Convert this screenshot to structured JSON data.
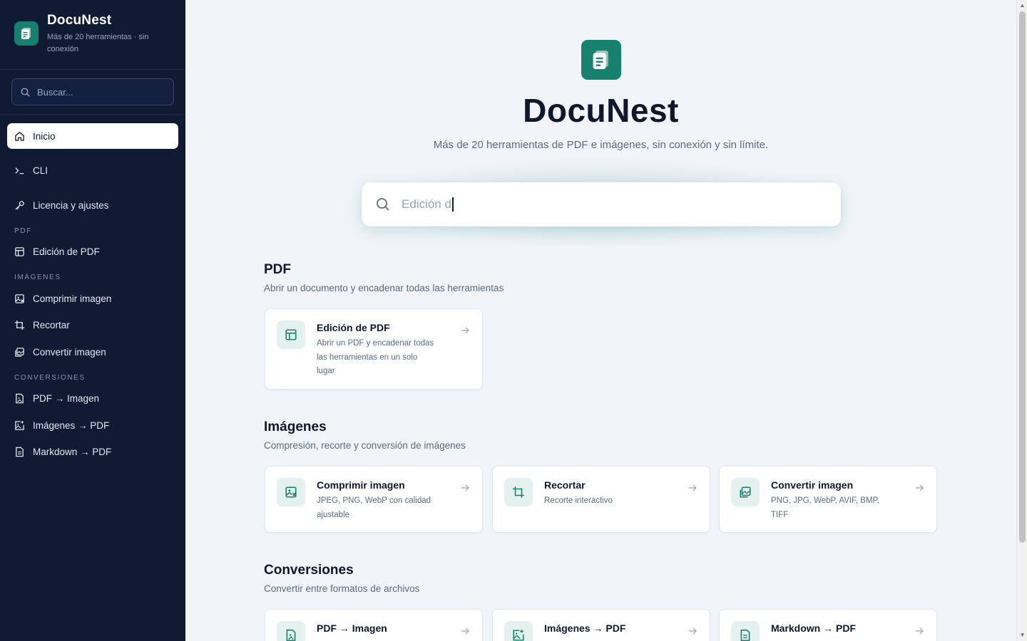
{
  "brand": {
    "title": "DocuNest",
    "subtitle": "Más de 20 herramientas · sin conexión"
  },
  "sidebar": {
    "search_placeholder": "Buscar...",
    "top_items": [
      {
        "label": "Inicio",
        "icon": "home-icon",
        "active": true
      },
      {
        "label": "CLI",
        "icon": "terminal-icon"
      },
      {
        "label": "Licencia y ajustes",
        "icon": "key-icon"
      }
    ],
    "sections": [
      {
        "title": "PDF",
        "items": [
          {
            "label": "Edición de PDF",
            "icon": "layout-icon"
          }
        ]
      },
      {
        "title": "IMÁGENES",
        "items": [
          {
            "label": "Comprimir imagen",
            "icon": "image-compress-icon"
          },
          {
            "label": "Recortar",
            "icon": "crop-icon"
          },
          {
            "label": "Convertir imagen",
            "icon": "images-icon"
          }
        ]
      },
      {
        "title": "CONVERSIONES",
        "items": [
          {
            "label": "PDF → Imagen",
            "icon": "file-image-icon"
          },
          {
            "label": "Imágenes → PDF",
            "icon": "image-plus-icon"
          },
          {
            "label": "Markdown → PDF",
            "icon": "file-text-icon"
          }
        ]
      }
    ]
  },
  "hero": {
    "title": "DocuNest",
    "subtitle": "Más de 20 herramientas de PDF e imágenes, sin conexión y sin límite.",
    "search_value": "Edición d"
  },
  "sections": [
    {
      "title": "PDF",
      "subtitle": "Abrir un documento y encadenar todas las herramientas",
      "cards": [
        {
          "title": "Edición de PDF",
          "desc": "Abrir un PDF y encadenar todas las herramientas en un solo lugar",
          "icon": "layout-icon"
        }
      ]
    },
    {
      "title": "Imágenes",
      "subtitle": "Compresión, recorte y conversión de imágenes",
      "cards": [
        {
          "title": "Comprimir imagen",
          "desc": "JPEG, PNG, WebP con calidad ajustable",
          "icon": "image-compress-icon"
        },
        {
          "title": "Recortar",
          "desc": "Recorte interactivo",
          "icon": "crop-icon"
        },
        {
          "title": "Convertir imagen",
          "desc": "PNG, JPG, WebP, AVIF, BMP, TIFF",
          "icon": "images-icon"
        }
      ]
    },
    {
      "title": "Conversiones",
      "subtitle": "Convertir entre formatos de archivos",
      "cards": [
        {
          "title": "PDF → Imagen",
          "desc": "",
          "icon": "file-image-icon"
        },
        {
          "title": "Imágenes → PDF",
          "desc": "",
          "icon": "image-plus-icon"
        },
        {
          "title": "Markdown → PDF",
          "desc": "",
          "icon": "file-text-icon"
        }
      ]
    }
  ],
  "colors": {
    "sidebar_bg": "#0f1a33",
    "accent": "#17806f",
    "page_bg": "#f1f4f8"
  }
}
